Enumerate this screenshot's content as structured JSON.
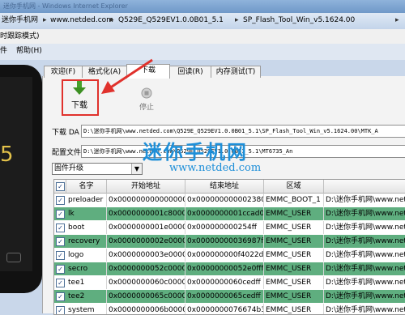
{
  "window": {
    "title": "迷你手机网 - Windows Internet Explorer",
    "breadcrumbs": [
      "迷你手机网",
      "www.netded.com",
      "Q529E_Q529EV1.0.0B01_5.1",
      "SP_Flash_Tool_Win_v5.1624.00"
    ]
  },
  "menubar": {
    "left_fragment": "时跟踪模式)",
    "file": "件",
    "help": "帮助(H)"
  },
  "tabs": [
    "欢迎(F)",
    "格式化(A)",
    "下载",
    "回读(R)",
    "内存测试(T)"
  ],
  "toolbar": {
    "download_label": "下载",
    "stop_label": "停止"
  },
  "download_agent": {
    "label": "下载 DA",
    "path": "D:\\迷你手机网\\www.netded.com\\Q529E_Q529EV1.0.0B01_5.1\\SP_Flash_Tool_Win_v5.1624.00\\MTK_A"
  },
  "scatter": {
    "label": "配置文件",
    "path": "D:\\迷你手机网\\www.netded.com\\Q529E_Q529EV1.0.0B01_5.1\\MT6735_An"
  },
  "mode_select": {
    "value": "固件升级"
  },
  "watermark": {
    "main": "迷你手机网",
    "url": "www.netded.com"
  },
  "phone": {
    "screen_text": "5"
  },
  "table": {
    "columns": [
      "名字",
      "开始地址",
      "结束地址",
      "区域",
      "位置"
    ],
    "rows": [
      {
        "name": "preloader",
        "start": "0x0000000000000000",
        "end": "0x0000000000023803",
        "region": "EMMC_BOOT_1",
        "location": "D:\\迷你手机网\\www.net",
        "highlight": false
      },
      {
        "name": "lk",
        "start": "0x0000000001c80000",
        "end": "0x0000000001ccad0b",
        "region": "EMMC_USER",
        "location": "D:\\迷你手机网\\www.net",
        "highlight": true
      },
      {
        "name": "boot",
        "start": "0x0000000001e00000",
        "end": "0x000000000254ff",
        "region": "EMMC_USER",
        "location": "D:\\迷你手机网\\www.net",
        "highlight": false
      },
      {
        "name": "recovery",
        "start": "0x0000000002e00000",
        "end": "0x00000000036987ff",
        "region": "EMMC_USER",
        "location": "D:\\迷你手机网\\www.net",
        "highlight": true
      },
      {
        "name": "logo",
        "start": "0x0000000003e00000",
        "end": "0x000000000f4022d",
        "region": "EMMC_USER",
        "location": "D:\\迷你手机网\\www.net",
        "highlight": false
      },
      {
        "name": "secro",
        "start": "0x0000000052c0000",
        "end": "0x00000000052e0fff",
        "region": "EMMC_USER",
        "location": "D:\\迷你手机网\\www.net",
        "highlight": true
      },
      {
        "name": "tee1",
        "start": "0x0000000060c0000",
        "end": "0x0000000060cedff",
        "region": "EMMC_USER",
        "location": "D:\\迷你手机网\\www.net",
        "highlight": false
      },
      {
        "name": "tee2",
        "start": "0x0000000065c0000",
        "end": "0x0000000065cedff",
        "region": "EMMC_USER",
        "location": "D:\\迷你手机网\\www.net",
        "highlight": true
      },
      {
        "name": "system",
        "start": "0x0000000006b00000",
        "end": "0x0000000076674b3",
        "region": "EMMC_USER",
        "location": "D:\\迷你手机网\\www.net",
        "highlight": false
      }
    ]
  },
  "colors": {
    "highlight_row": "#5fae7f",
    "arrow": "#e0312c",
    "watermark": "#1e8fd8"
  }
}
